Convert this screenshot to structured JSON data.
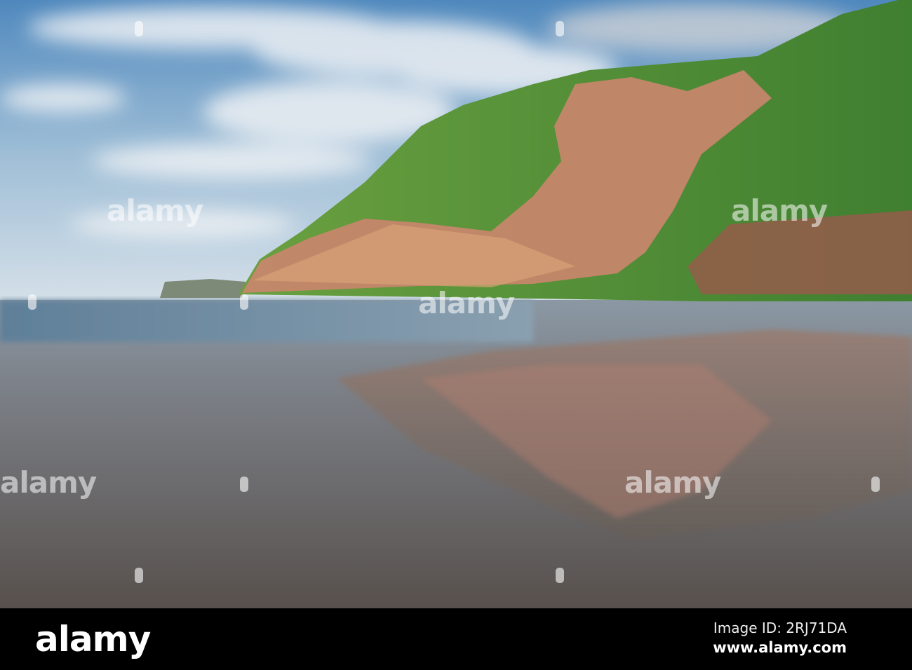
{
  "image": {
    "colors": {
      "sky_top": "#5a8fbf",
      "sky_low": "#c9d9e6",
      "grass": "#5f9a3a",
      "rock": "#c88670",
      "sand": "#6b6660"
    }
  },
  "watermark": {
    "logo_text": "alamy"
  },
  "footer": {
    "logo": "alamy",
    "image_id": "Image ID: 2RJ71DA",
    "url": "www.alamy.com"
  }
}
